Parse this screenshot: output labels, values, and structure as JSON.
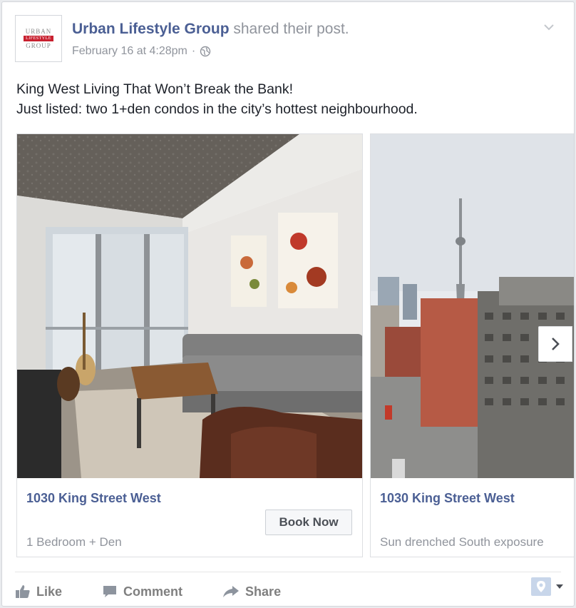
{
  "post": {
    "page_name": "Urban Lifestyle Group",
    "action_text": "shared their post.",
    "timestamp": "February 16 at 4:28pm",
    "separator": "·",
    "logo": {
      "line1": "URBAN",
      "line2": "LIFESTYLE",
      "line3": "GROUP"
    },
    "text_lines": [
      "King West Living That Won’t Break the Bank!",
      "Just listed: two 1+den condos in the city’s hottest neighbourhood."
    ]
  },
  "carousel": {
    "cards": [
      {
        "title": "1030 King Street West",
        "description": "1 Bedroom + Den",
        "cta": "Book Now"
      },
      {
        "title": "1030 King Street West",
        "description": "Sun drenched South exposure"
      }
    ]
  },
  "actions": {
    "like": "Like",
    "comment": "Comment",
    "share": "Share"
  },
  "colors": {
    "link": "#4b5f94",
    "muted": "#90949c",
    "action": "#7f7f7f",
    "brand_red": "#c8202f"
  }
}
